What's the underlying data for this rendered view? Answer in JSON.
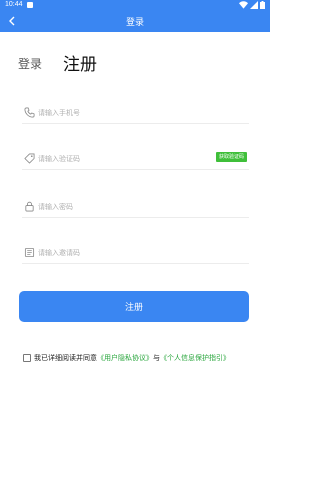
{
  "status_bar": {
    "time": "10:44"
  },
  "appbar": {
    "title": "登录"
  },
  "tabs": {
    "login": "登录",
    "register": "注册"
  },
  "form": {
    "phone_placeholder": "请输入手机号",
    "sms_code_placeholder": "请输入验证码",
    "get_code_button": "获取验证码",
    "password_placeholder": "请输入密码",
    "invite_code_placeholder": "请输入邀请码",
    "submit_label": "注册"
  },
  "agreement": {
    "prefix": "我已详细阅读并同意",
    "privacy_link": "《用户隐私协议》",
    "conjunction": "与",
    "personal_info_link": "《个人信息保护指引》"
  },
  "colors": {
    "primary": "#3a86f2",
    "link": "#27a53b",
    "code_button": "#3fbf3a"
  },
  "icons": {
    "back": "arrow-left",
    "phone": "phone",
    "tag": "tag",
    "lock": "lock",
    "invite": "card"
  }
}
